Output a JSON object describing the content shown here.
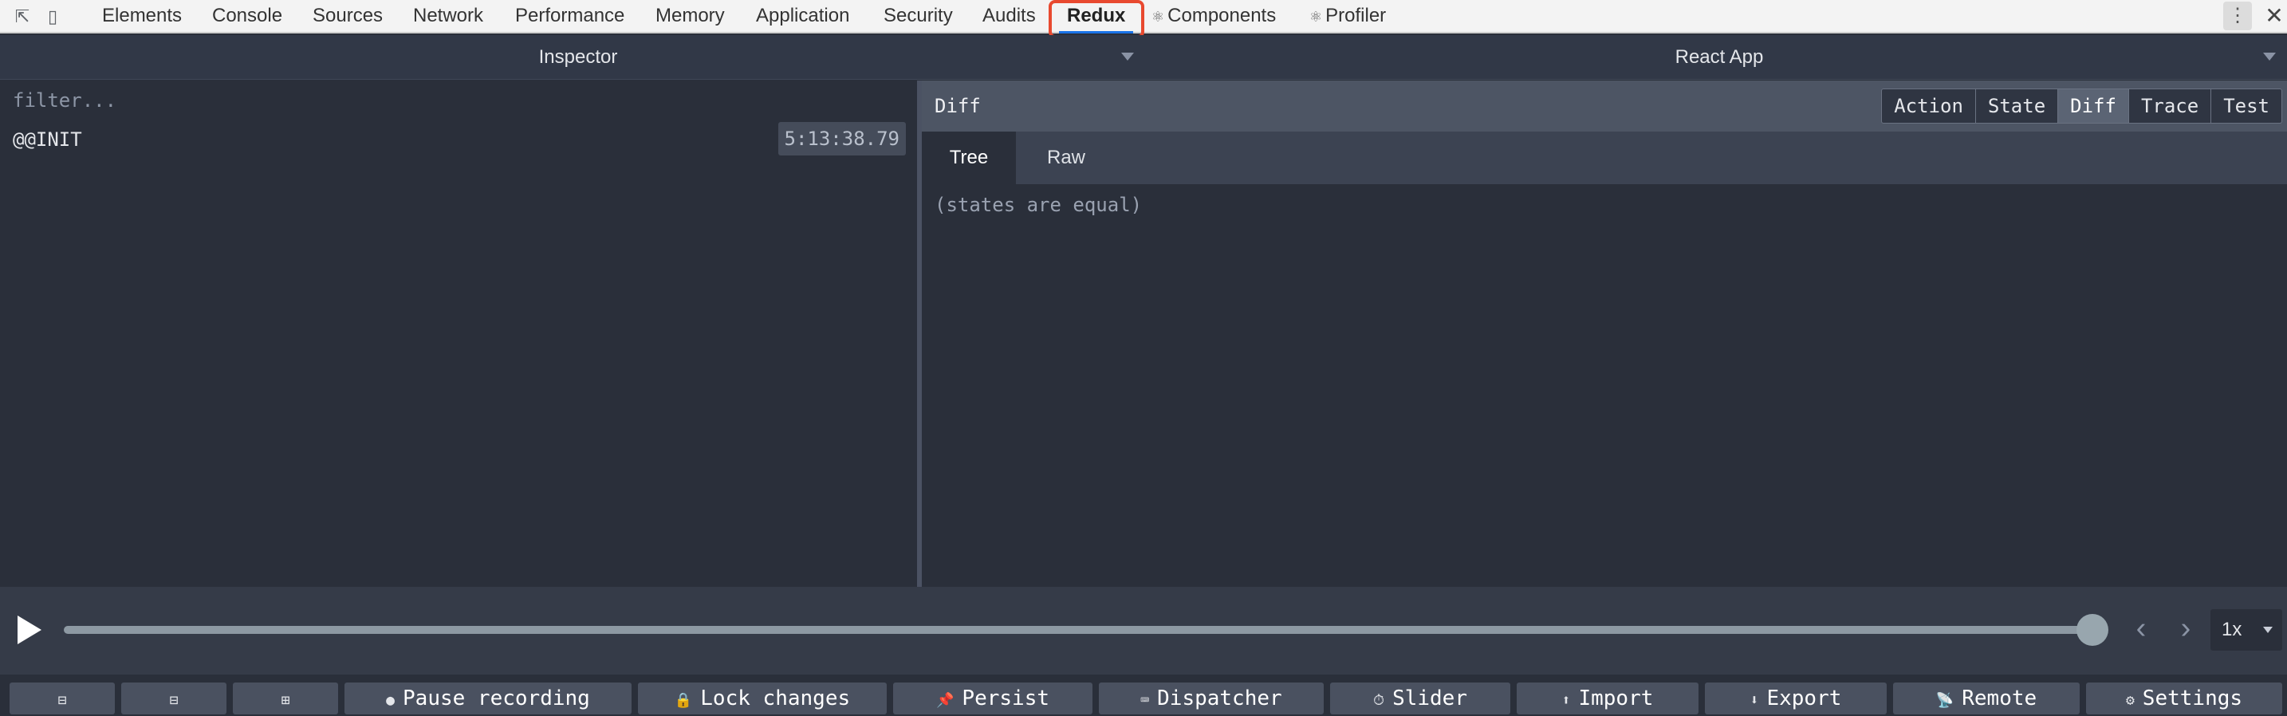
{
  "devtools": {
    "tabs": [
      {
        "label": "Elements"
      },
      {
        "label": "Console"
      },
      {
        "label": "Sources"
      },
      {
        "label": "Network"
      },
      {
        "label": "Performance"
      },
      {
        "label": "Memory"
      },
      {
        "label": "Application"
      },
      {
        "label": "Security"
      },
      {
        "label": "Audits"
      },
      {
        "label": "Redux"
      },
      {
        "label": "Components",
        "glyph": "⚛"
      },
      {
        "label": "Profiler",
        "glyph": "⚛"
      }
    ],
    "active_tab": "Redux",
    "menu_icon": "⋮",
    "close_icon": "✕"
  },
  "monitor": {
    "left_select": "Inspector",
    "right_select": "React App"
  },
  "action_list": {
    "filter_placeholder": "filter...",
    "items": [
      {
        "name": "@@INIT",
        "time": "5:13:38.79"
      }
    ]
  },
  "inspector": {
    "title": "Diff",
    "tabs": [
      "Action",
      "State",
      "Diff",
      "Trace",
      "Test"
    ],
    "active_tab": "Diff",
    "subtabs": [
      "Tree",
      "Raw"
    ],
    "active_subtab": "Tree",
    "content": "(states are equal)"
  },
  "slider": {
    "position_fraction": 1.0,
    "speed": "1x"
  },
  "bottom_bar": {
    "layout_icons": [
      "⊟",
      "⊟",
      "⊞"
    ],
    "buttons": [
      {
        "icon": "●",
        "label": "Pause recording"
      },
      {
        "icon": "🔒",
        "label": "Lock changes"
      },
      {
        "icon": "📌",
        "label": "Persist"
      },
      {
        "icon": "⌨",
        "label": "Dispatcher"
      },
      {
        "icon": "⏱",
        "label": "Slider"
      },
      {
        "icon": "⬆",
        "label": "Import"
      },
      {
        "icon": "⬇",
        "label": "Export"
      },
      {
        "icon": "📡",
        "label": "Remote"
      },
      {
        "icon": "⚙",
        "label": "Settings"
      }
    ]
  },
  "colors": {
    "highlight": "#e8492f",
    "panel_bg": "#2a2f3a",
    "header_bg": "#313847",
    "button_bg": "#4a5160"
  }
}
